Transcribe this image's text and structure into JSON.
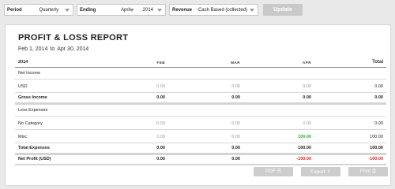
{
  "filters": {
    "period": {
      "label": "Period",
      "value": "Quarterly"
    },
    "ending": {
      "label": "Ending",
      "month": "April",
      "year": "2014"
    },
    "revenue": {
      "label": "Revenue",
      "value": "Cash Based (collected)"
    }
  },
  "update_label": "Update",
  "report": {
    "title": "PROFIT & LOSS REPORT",
    "range_start": "Feb 1, 2014",
    "range_sep": "to",
    "range_end": "Apr 30, 2014",
    "header": {
      "label": "2014",
      "cols": [
        "FEB",
        "MAR",
        "APR"
      ],
      "total": "Total"
    },
    "net_income_label": "Net Income",
    "usd": {
      "name": "USD",
      "values": [
        "0.00",
        "0.00",
        "0.00"
      ],
      "total": "0.00"
    },
    "gross_income": {
      "name": "Gross Income",
      "values": [
        "0.00",
        "0.00",
        "0.00"
      ],
      "total": "0.00"
    },
    "less_expenses_label": "Less Expenses",
    "no_category": {
      "name": "No Category",
      "values": [
        "0.00",
        "0.00",
        "0.00"
      ],
      "total": "0.00"
    },
    "misc": {
      "name": "Misc",
      "values": [
        "0.00",
        "0.00",
        "100.00"
      ],
      "total": "100.00"
    },
    "total_expenses": {
      "name": "Total Expenses",
      "values": [
        "0.00",
        "0.00",
        "100.00"
      ],
      "total": "100.00"
    },
    "net_profit": {
      "name": "Net Profit (USD)",
      "values": [
        "0.00",
        "0.00",
        "-100.00"
      ],
      "total": "-100.00"
    }
  },
  "actions": {
    "pdf": "PDF 🗎",
    "export": "Export ⇪",
    "print": "Print ⎙"
  },
  "colors": {
    "positive": "#3aa53a",
    "negative": "#d62a2a"
  }
}
